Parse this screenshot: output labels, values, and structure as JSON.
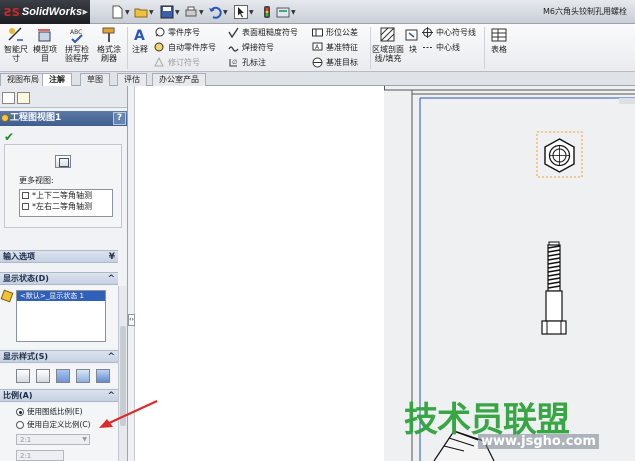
{
  "app": {
    "name": "SolidWorks",
    "document_title": "M6六角头铰制孔用螺栓"
  },
  "ribbon": {
    "smart_dim": "智能尺寸",
    "model_items": "模型项目",
    "spell_check": "拼写检验程序",
    "format_painter": "格式涂刷器",
    "note": "注释",
    "balloon": "零件序号",
    "auto_balloon": "自动零件序号",
    "magnetic_line": "修订符号",
    "surface_finish": "表面粗糙度符号",
    "weld_symbol": "焊接符号",
    "hole_callout": "孔标注",
    "geom_tol": "形位公差",
    "datum_feature": "基准特征",
    "datum_target": "基准目标",
    "area_hatch": "区域剖面线/填充",
    "block": "块",
    "center_mark": "中心符号线",
    "centerline": "中心线",
    "table": "表格"
  },
  "tabs": [
    "视图布局",
    "注解",
    "草图",
    "评估",
    "办公室产品"
  ],
  "active_tab": "注解",
  "panel": {
    "title": "工程图视图1",
    "help": "?",
    "more_views_label": "更多视图:",
    "views": [
      "*上下二等角轴测",
      "*左右二等角轴测"
    ],
    "sections": {
      "input_options": "输入选项",
      "display_state": "显示状态(D)",
      "display_style": "显示样式(S)",
      "scale": "比例(A)"
    },
    "display_state_item": "<默认>_显示状态 1",
    "scale_options": [
      "使用图纸比例(E)",
      "使用自定义比例(C)"
    ],
    "scale_combo": "2:1",
    "scale_ratio": "2:1"
  },
  "watermark": {
    "text": "技术员联盟",
    "url": "www.jsgho.com"
  },
  "colors": {
    "accent_red": "#e02a2a",
    "panel_header": "#4a6a9b",
    "watermark_green": "#2fa33b",
    "selection_orange": "#f0a030"
  }
}
